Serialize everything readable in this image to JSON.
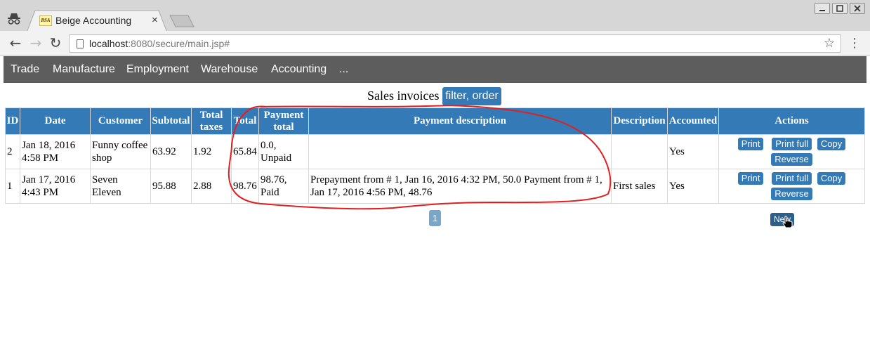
{
  "browser": {
    "tab_title": "Beige Accounting",
    "favicon_text": "BSA",
    "url_host": "localhost",
    "url_rest": ":8080/secure/main.jsp#",
    "tab_close": "×",
    "back": "←",
    "forward": "→",
    "reload": "↻",
    "star": "☆",
    "menu": "⋮"
  },
  "nav": {
    "items": [
      "Trade",
      "Manufacture",
      "Employment",
      "Warehouse",
      "Accounting",
      "..."
    ]
  },
  "page": {
    "title": "Sales invoices",
    "filter_label": "filter, order"
  },
  "table": {
    "headers": [
      "ID",
      "Date",
      "Customer",
      "Subtotal",
      "Total taxes",
      "Total",
      "Payment total",
      "Payment description",
      "Description",
      "Accounted",
      "Actions"
    ],
    "rows": [
      {
        "id": "2",
        "date": "Jan 18, 2016 4:58 PM",
        "customer": "Funny coffee shop",
        "subtotal": "63.92",
        "taxes": "1.92",
        "total": "65.84",
        "payment_total": "0.0, Unpaid",
        "payment_description": "",
        "description": "",
        "accounted": "Yes"
      },
      {
        "id": "1",
        "date": "Jan 17, 2016 4:43 PM",
        "customer": "Seven Eleven",
        "subtotal": "95.88",
        "taxes": "2.88",
        "total": "98.76",
        "payment_total": "98.76, Paid",
        "payment_description": "Prepayment from # 1, Jan 16, 2016 4:32 PM, 50.0 Payment from # 1, Jan 17, 2016 4:56 PM, 48.76",
        "description": "First sales",
        "accounted": "Yes"
      }
    ],
    "actions": {
      "print": "Print",
      "print_full": "Print full",
      "copy": "Copy",
      "reverse": "Reverse"
    }
  },
  "pagination": {
    "current_page": "1"
  },
  "new_button": "New",
  "colors": {
    "accent": "#337ab7",
    "nav_bg": "#5d5d5d",
    "annotation": "#e02020"
  },
  "icons": [
    "incognito-icon",
    "favicon",
    "close-icon",
    "back-icon",
    "forward-icon",
    "reload-icon",
    "page-icon",
    "star-icon",
    "menu-icon",
    "hand-cursor-icon"
  ]
}
